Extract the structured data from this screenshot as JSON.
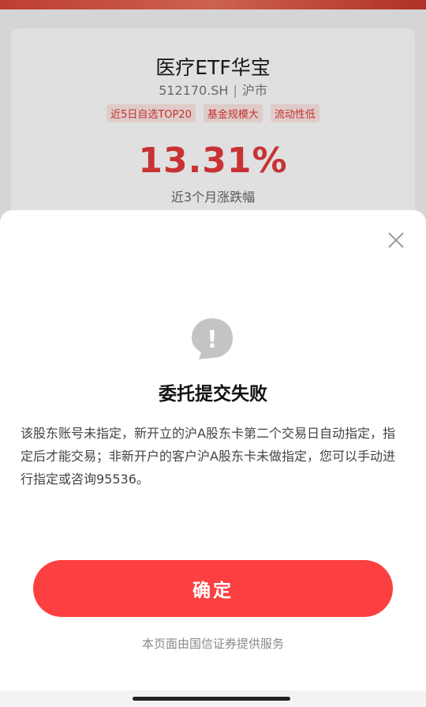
{
  "background": {
    "fund_name": "医疗ETF华宝",
    "fund_code": "512170.SH",
    "market": "沪市",
    "tags": [
      "近5日自选TOP20",
      "基金规模大",
      "流动性低"
    ],
    "return_value": "13.31%",
    "return_label": "近3个月涨跌幅"
  },
  "dialog": {
    "title": "委托提交失败",
    "message": "该股东账号未指定，新开立的沪A股东卡第二个交易日自动指定，指定后才能交易；非新开户的客户沪A股东卡未做指定，您可以手动进行指定或咨询95536。",
    "confirm_label": "确定",
    "provider_note": "本页面由国信证券提供服务",
    "alert_glyph": "!",
    "icons": {
      "close": "close-icon",
      "alert": "alert-icon"
    }
  },
  "colors": {
    "accent": "#fc3f41",
    "rate": "#e4393c",
    "tag_bg": "#fde8e6",
    "tag_text": "#e03a34"
  }
}
